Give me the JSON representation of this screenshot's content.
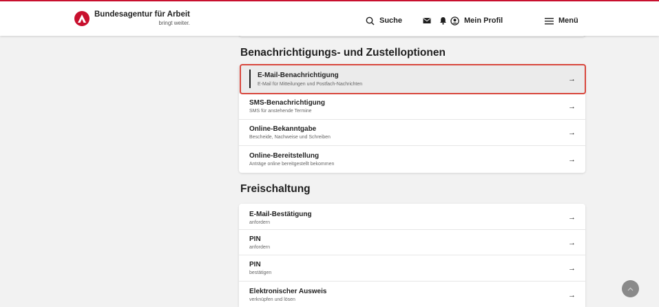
{
  "header": {
    "brand_title": "Bundesagentur für Arbeit",
    "brand_tagline": "bringt weiter.",
    "search_label": "Suche",
    "profile_label": "Mein Profil",
    "menu_label": "Menü"
  },
  "sections": [
    {
      "title": "Benachrichtigungs- und Zustelloptionen",
      "items": [
        {
          "title": "E-Mail-Benachrichtigung",
          "subtitle": "E-Mail für Mitteilungen und Postfach-Nachrichten",
          "arrow": "→"
        },
        {
          "title": "SMS-Benachrichtigung",
          "subtitle": "SMS für anstehende Termine",
          "arrow": "→"
        },
        {
          "title": "Online-Bekanntgabe",
          "subtitle": "Bescheide, Nachweise und Schreiben",
          "arrow": "→"
        },
        {
          "title": "Online-Bereitstellung",
          "subtitle": "Anträge online bereitgestellt bekommen",
          "arrow": "→"
        }
      ]
    },
    {
      "title": "Freischaltung",
      "items": [
        {
          "title": "E-Mail-Bestätigung",
          "subtitle": "anfordern",
          "arrow": "→"
        },
        {
          "title": "PIN",
          "subtitle": "anfordern",
          "arrow": "→"
        },
        {
          "title": "PIN",
          "subtitle": "bestätigen",
          "arrow": "→"
        },
        {
          "title": "Elektronischer Ausweis",
          "subtitle": "verknüpfen und lösen",
          "arrow": "→"
        }
      ]
    }
  ],
  "colors": {
    "brand_red": "#c8102e",
    "highlight_border": "#d8453b",
    "active_row_bg": "#ebebeb"
  },
  "icons": [
    "logo-icon",
    "search-icon",
    "mail-icon",
    "bell-icon",
    "profile-icon",
    "menu-icon",
    "arrow-right-icon",
    "chevron-up-icon"
  ]
}
